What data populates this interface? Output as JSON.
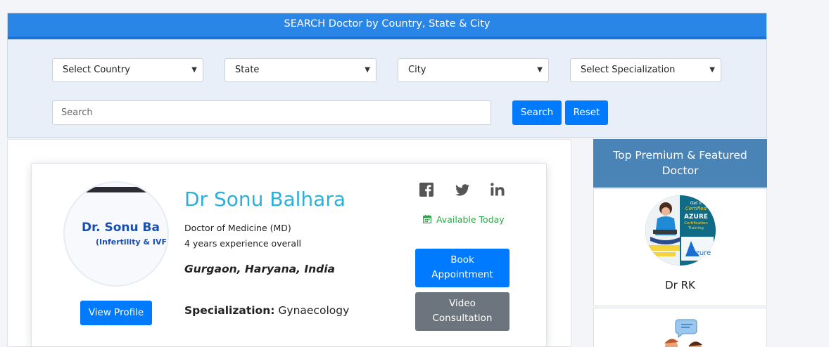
{
  "search": {
    "header": "SEARCH Doctor by Country, State & City",
    "country_select": "Select Country",
    "state_select": "State",
    "city_select": "City",
    "specialization_select": "Select Specialization",
    "search_placeholder": "Search",
    "search_button": "Search",
    "reset_button": "Reset"
  },
  "doctor_card": {
    "avatar_text_line1": "Dr. Sonu Ba",
    "avatar_text_line2": "(Infertility & IVF",
    "name": "Dr Sonu Balhara",
    "degree": "Doctor of Medicine (MD)",
    "experience": "4 years experience overall",
    "location": "Gurgaon, Haryana, India",
    "specialization_label": "Specialization:",
    "specialization_value": "Gynaecology",
    "availability": "Available Today",
    "view_profile_button": "View Profile",
    "book_button": "Book Appointment",
    "video_button": "Video Consultation",
    "social_icons": [
      "facebook-icon",
      "twitter-icon",
      "linkedin-icon"
    ]
  },
  "sidebar": {
    "header": "Top Premium & Featured Doctor",
    "featured": [
      {
        "name": "Dr RK",
        "badge_line1": "Get it",
        "badge_line2": "Certified",
        "badge_line3": "AZURE",
        "badge_line4": "Certification",
        "badge_line5": "Training",
        "badge_logo": "Azure"
      }
    ]
  },
  "colors": {
    "primary": "#007bff",
    "header_blue": "#2a86e6",
    "sidebar_header": "#4a83b5",
    "name_cyan": "#2bb0db",
    "available_green": "#28a745",
    "secondary": "#6c757d"
  }
}
